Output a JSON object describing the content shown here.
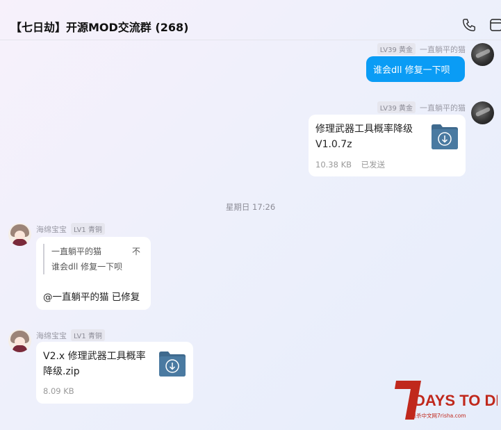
{
  "header": {
    "title": "【七日劫】开源MOD交流群 (268)",
    "phone_icon": "phone-icon",
    "more_icon": "window-icon"
  },
  "messages": [
    {
      "sender": "一直躺平的猫",
      "badge": "LV39 黄金",
      "text": "谁会dll  修复一下呗"
    },
    {
      "sender": "一直躺平的猫",
      "badge": "LV39 黄金",
      "file": {
        "name_line1": "修理武器工具概率降级",
        "name_line2": "V1.0.7z",
        "size": "10.38 KB",
        "status": "已发送"
      }
    },
    {
      "divider": "星期日 17:26"
    },
    {
      "sender": "海绵宝宝",
      "badge": "LV1 青铜",
      "quote": {
        "author": "一直躺平的猫",
        "suffix": "不",
        "text": "谁会dll 修复一下呗"
      },
      "text": "@一直躺平的猫 已修复"
    },
    {
      "sender": "海绵宝宝",
      "badge": "LV1 青铜",
      "file": {
        "name_line1": "V2.x 修理武器工具概率",
        "name_line2": "降级.zip",
        "size": "8.09 KB"
      }
    }
  ],
  "watermark": {
    "title": "DAYS TO DIE",
    "numeral": "7",
    "subtitle": "七日杀中文网7risha.com"
  },
  "colors": {
    "accent_blue": "#0a9cf5",
    "folder_blue": "#3f6a8e",
    "logo_red": "#c0281c"
  }
}
